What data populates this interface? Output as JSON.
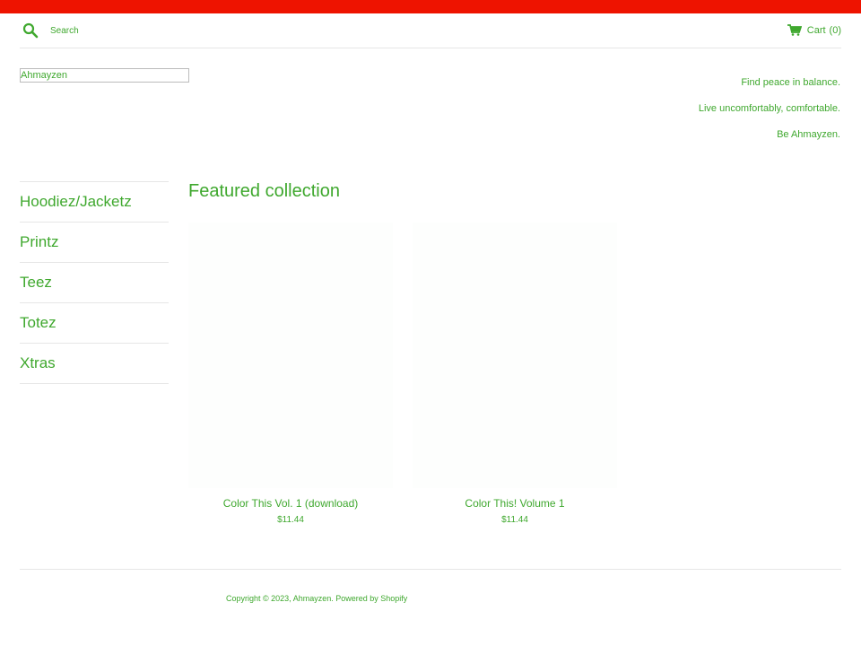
{
  "colors": {
    "top_bar": "#ee1300",
    "accent": "#3fa82e"
  },
  "header": {
    "search_placeholder": "Search",
    "search_icon": "search-icon",
    "cart_icon": "cart-icon",
    "cart_label": "Cart",
    "cart_count": "(0)"
  },
  "brand": {
    "logo_text": "Ahmayzen",
    "taglines": [
      "Find peace in balance.",
      "Live uncomfortably, comfortable.",
      "Be Ahmayzen."
    ]
  },
  "sidebar": {
    "items": [
      {
        "label": "Hoodiez/Jacketz"
      },
      {
        "label": "Printz"
      },
      {
        "label": "Teez"
      },
      {
        "label": "Totez"
      },
      {
        "label": "Xtras"
      }
    ]
  },
  "main": {
    "section_title": "Featured collection",
    "products": [
      {
        "title": "Color This Vol. 1 (download)",
        "price": "$11.44"
      },
      {
        "title": "Color This! Volume 1",
        "price": "$11.44"
      }
    ]
  },
  "footer": {
    "copyright_prefix": "Copyright © 2023, ",
    "store_link": "Ahmayzen",
    "separator": ". ",
    "powered_by": "Powered by Shopify"
  }
}
